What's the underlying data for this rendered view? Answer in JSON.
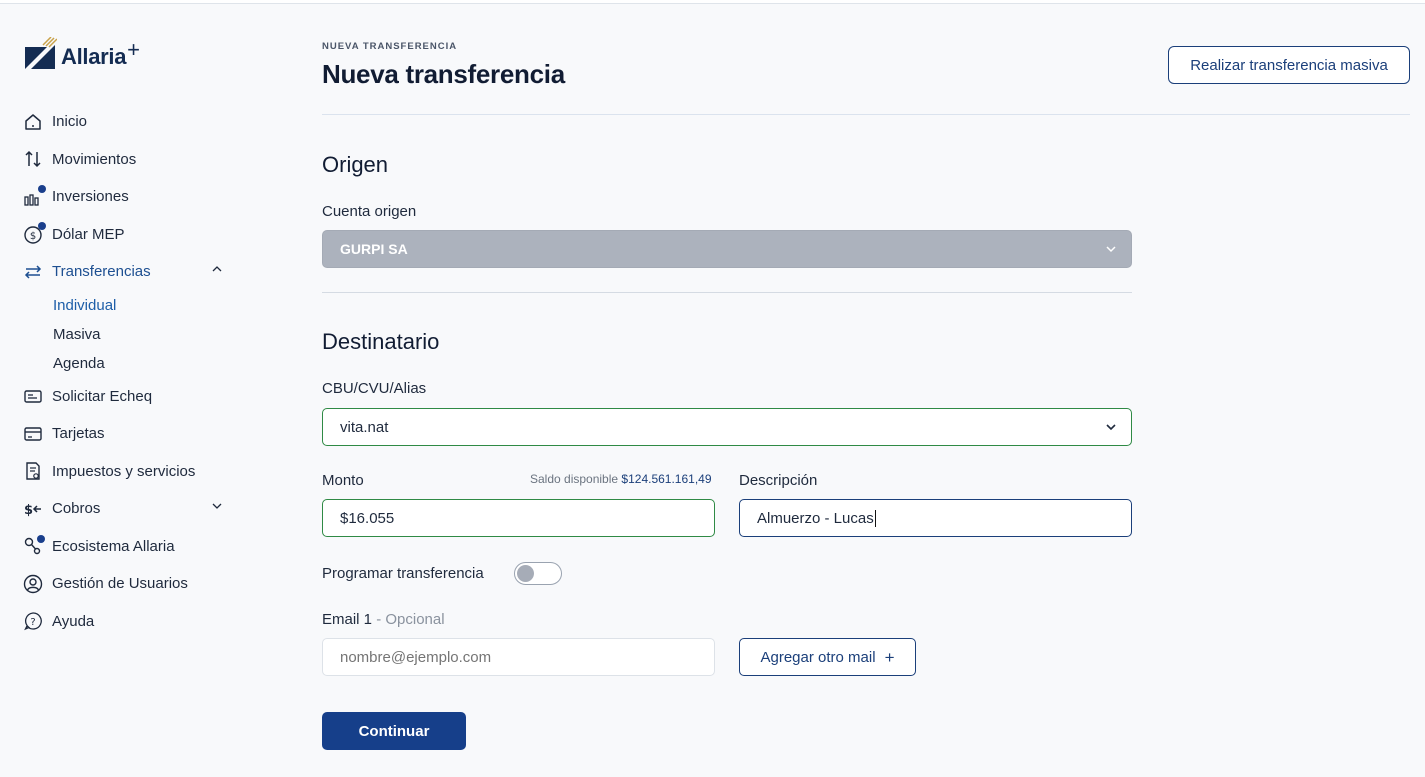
{
  "brand": {
    "name": "Allaria",
    "plus": "+"
  },
  "sidebar": {
    "items": [
      {
        "label": "Inicio",
        "icon": "home-icon"
      },
      {
        "label": "Movimientos",
        "icon": "arrows-updown-icon"
      },
      {
        "label": "Inversiones",
        "icon": "bar-chart-icon"
      },
      {
        "label": "Dólar MEP",
        "icon": "dollar-circle-icon"
      },
      {
        "label": "Transferencias",
        "icon": "transfer-icon"
      },
      {
        "label": "Solicitar Echeq",
        "icon": "echeq-icon"
      },
      {
        "label": "Tarjetas",
        "icon": "card-icon"
      },
      {
        "label": "Impuestos y servicios",
        "icon": "receipt-icon"
      },
      {
        "label": "Cobros",
        "icon": "cobros-icon"
      },
      {
        "label": "Ecosistema Allaria",
        "icon": "network-icon"
      },
      {
        "label": "Gestión de Usuarios",
        "icon": "user-circle-icon"
      },
      {
        "label": "Ayuda",
        "icon": "help-icon"
      }
    ],
    "transfer_sub": [
      "Individual",
      "Masiva",
      "Agenda"
    ]
  },
  "header": {
    "breadcrumb": "NUEVA TRANSFERENCIA",
    "title": "Nueva transferencia",
    "bulk_button": "Realizar transferencia masiva"
  },
  "origen": {
    "title": "Origen",
    "account_label": "Cuenta origen",
    "account_value": "GURPI SA"
  },
  "destinatario": {
    "title": "Destinatario",
    "cbu_label": "CBU/CVU/Alias",
    "cbu_value": "vita.nat",
    "amount_label": "Monto",
    "saldo_label": "Saldo disponible",
    "saldo_value": "$124.561.161,49",
    "amount_value": "$16.055",
    "desc_label": "Descripción",
    "desc_value": "Almuerzo - Lucas",
    "schedule_label": "Programar transferencia",
    "schedule_on": false,
    "email_label": "Email 1",
    "email_optional": " - Opcional",
    "email_placeholder": "nombre@ejemplo.com",
    "add_mail_button": "Agregar otro mail",
    "continue_button": "Continuar"
  },
  "colors": {
    "navy": "#163f8a",
    "green_border": "#2f8a45",
    "active_nav": "#1d4f91"
  }
}
